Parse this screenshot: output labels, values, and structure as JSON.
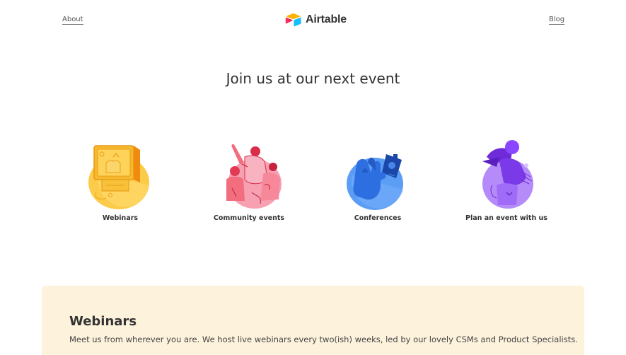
{
  "nav": {
    "about_label": "About",
    "blog_label": "Blog",
    "logo_text": "Airtable"
  },
  "main": {
    "headline": "Join us at our next event"
  },
  "events": [
    {
      "label": "Webinars",
      "icon": "webinars-illustration-icon",
      "color": "#f9c93c"
    },
    {
      "label": "Community events",
      "icon": "community-illustration-icon",
      "color": "#f26d7d"
    },
    {
      "label": "Conferences",
      "icon": "conferences-illustration-icon",
      "color": "#2d7ff9"
    },
    {
      "label": "Plan an event with us",
      "icon": "plan-event-illustration-icon",
      "color": "#8b46ff"
    }
  ],
  "webinars_section": {
    "title": "Webinars",
    "description": "Meet us from wherever you are. We host live webinars every two(ish) weeks, led by our lovely CSMs and Product Specialists."
  },
  "colors": {
    "panel_background": "#fdf2dc",
    "text": "#333333"
  }
}
